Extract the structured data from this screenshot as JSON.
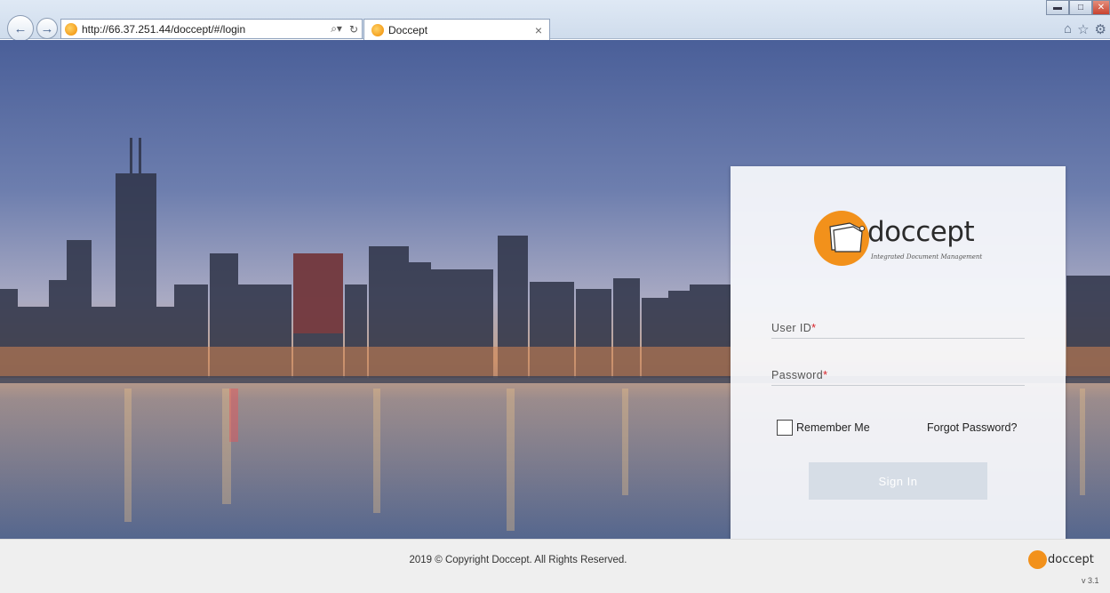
{
  "browser": {
    "url": "http://66.37.251.44/doccept/#/login",
    "tab_title": "Doccept",
    "tab_close": "×",
    "back_icon": "arrow-left-icon",
    "forward_icon": "arrow-right-icon"
  },
  "logo": {
    "word": "doccept",
    "tagline": "Integrated Document Management"
  },
  "login": {
    "userid_label": "User ID",
    "password_label": "Password",
    "required_mark": "*",
    "remember_label": "Remember Me",
    "forgot_label": "Forgot Password?",
    "signin_label": "Sign In"
  },
  "footer": {
    "copyright": "2019 © Copyright Doccept. All Rights Reserved.",
    "logo_word": "doccept",
    "version": "v 3.1"
  },
  "colors": {
    "brand_orange": "#f2911b",
    "required_red": "#d8232a",
    "signin_disabled": "#d6dde6"
  }
}
